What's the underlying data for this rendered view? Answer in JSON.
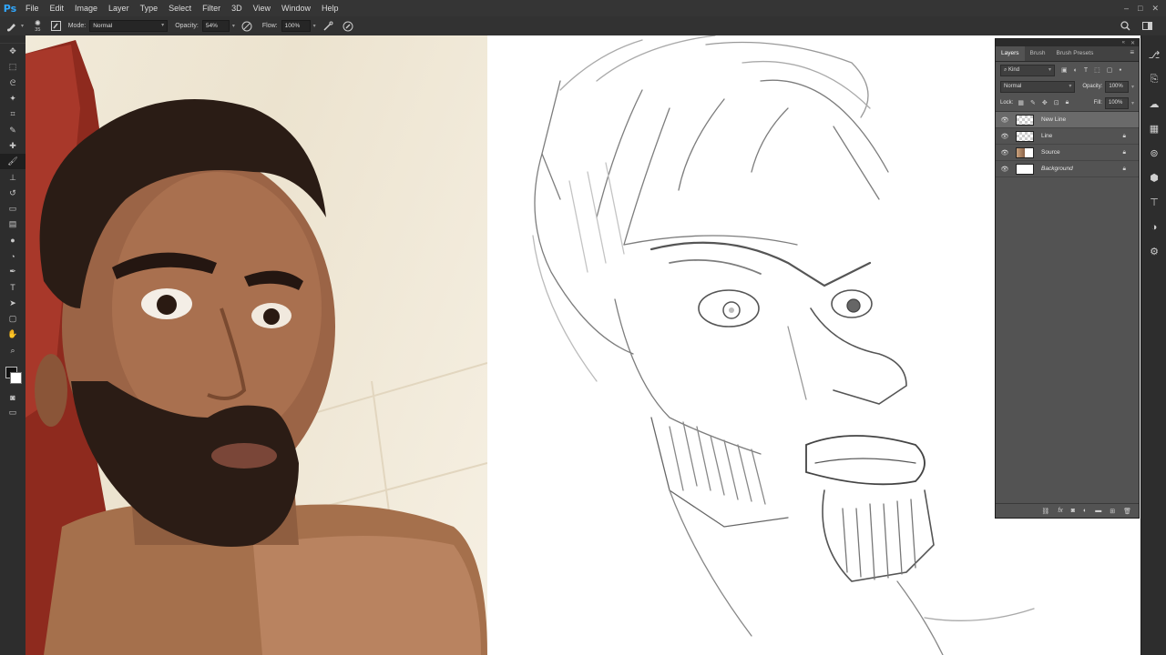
{
  "app": {
    "logo": "Ps",
    "menu": [
      "File",
      "Edit",
      "Image",
      "Layer",
      "Type",
      "Select",
      "Filter",
      "3D",
      "View",
      "Window",
      "Help"
    ],
    "window_controls": [
      "–",
      "□",
      "✕"
    ]
  },
  "options_bar": {
    "brush_size": "35",
    "mode_label": "Mode:",
    "mode_value": "Normal",
    "opacity_label": "Opacity:",
    "opacity_value": "54%",
    "flow_label": "Flow:",
    "flow_value": "100%"
  },
  "toolbar": {
    "tools": [
      {
        "name": "move-tool",
        "glyph": "✥"
      },
      {
        "name": "marquee-tool",
        "glyph": "⬚"
      },
      {
        "name": "lasso-tool",
        "glyph": "ᘓ"
      },
      {
        "name": "magic-wand-tool",
        "glyph": "✦"
      },
      {
        "name": "crop-tool",
        "glyph": "⌗"
      },
      {
        "name": "eyedropper-tool",
        "glyph": "✎"
      },
      {
        "name": "healing-tool",
        "glyph": "✚"
      },
      {
        "name": "brush-tool",
        "glyph": "🖌",
        "active": true
      },
      {
        "name": "stamp-tool",
        "glyph": "⊥"
      },
      {
        "name": "history-brush-tool",
        "glyph": "↺"
      },
      {
        "name": "eraser-tool",
        "glyph": "▭"
      },
      {
        "name": "gradient-tool",
        "glyph": "▤"
      },
      {
        "name": "blur-tool",
        "glyph": "●"
      },
      {
        "name": "dodge-tool",
        "glyph": "◔"
      },
      {
        "name": "pen-tool",
        "glyph": "✒"
      },
      {
        "name": "type-tool",
        "glyph": "T"
      },
      {
        "name": "path-select-tool",
        "glyph": "➤"
      },
      {
        "name": "shape-tool",
        "glyph": "▢"
      },
      {
        "name": "hand-tool",
        "glyph": "✋"
      },
      {
        "name": "zoom-tool",
        "glyph": "⌕"
      }
    ]
  },
  "layers_panel": {
    "tabs": [
      "Layers",
      "Brush",
      "Brush Presets"
    ],
    "filter_label": "Kind",
    "blend_mode": "Normal",
    "opacity_label": "Opacity:",
    "opacity_value": "100%",
    "lock_label": "Lock:",
    "fill_label": "Fill:",
    "fill_value": "100%",
    "layers": [
      {
        "name": "New Line",
        "thumb": "check",
        "selected": true,
        "locked": false,
        "italic": false
      },
      {
        "name": "Line",
        "thumb": "check",
        "selected": false,
        "locked": true,
        "italic": false
      },
      {
        "name": "Source",
        "thumb": "src",
        "selected": false,
        "locked": true,
        "italic": false
      },
      {
        "name": "Background",
        "thumb": "white",
        "selected": false,
        "locked": true,
        "italic": true
      }
    ]
  },
  "colors": {
    "ps_blue": "#31a8ff",
    "ui_dark": "#282828",
    "panel_gray": "#535353"
  }
}
